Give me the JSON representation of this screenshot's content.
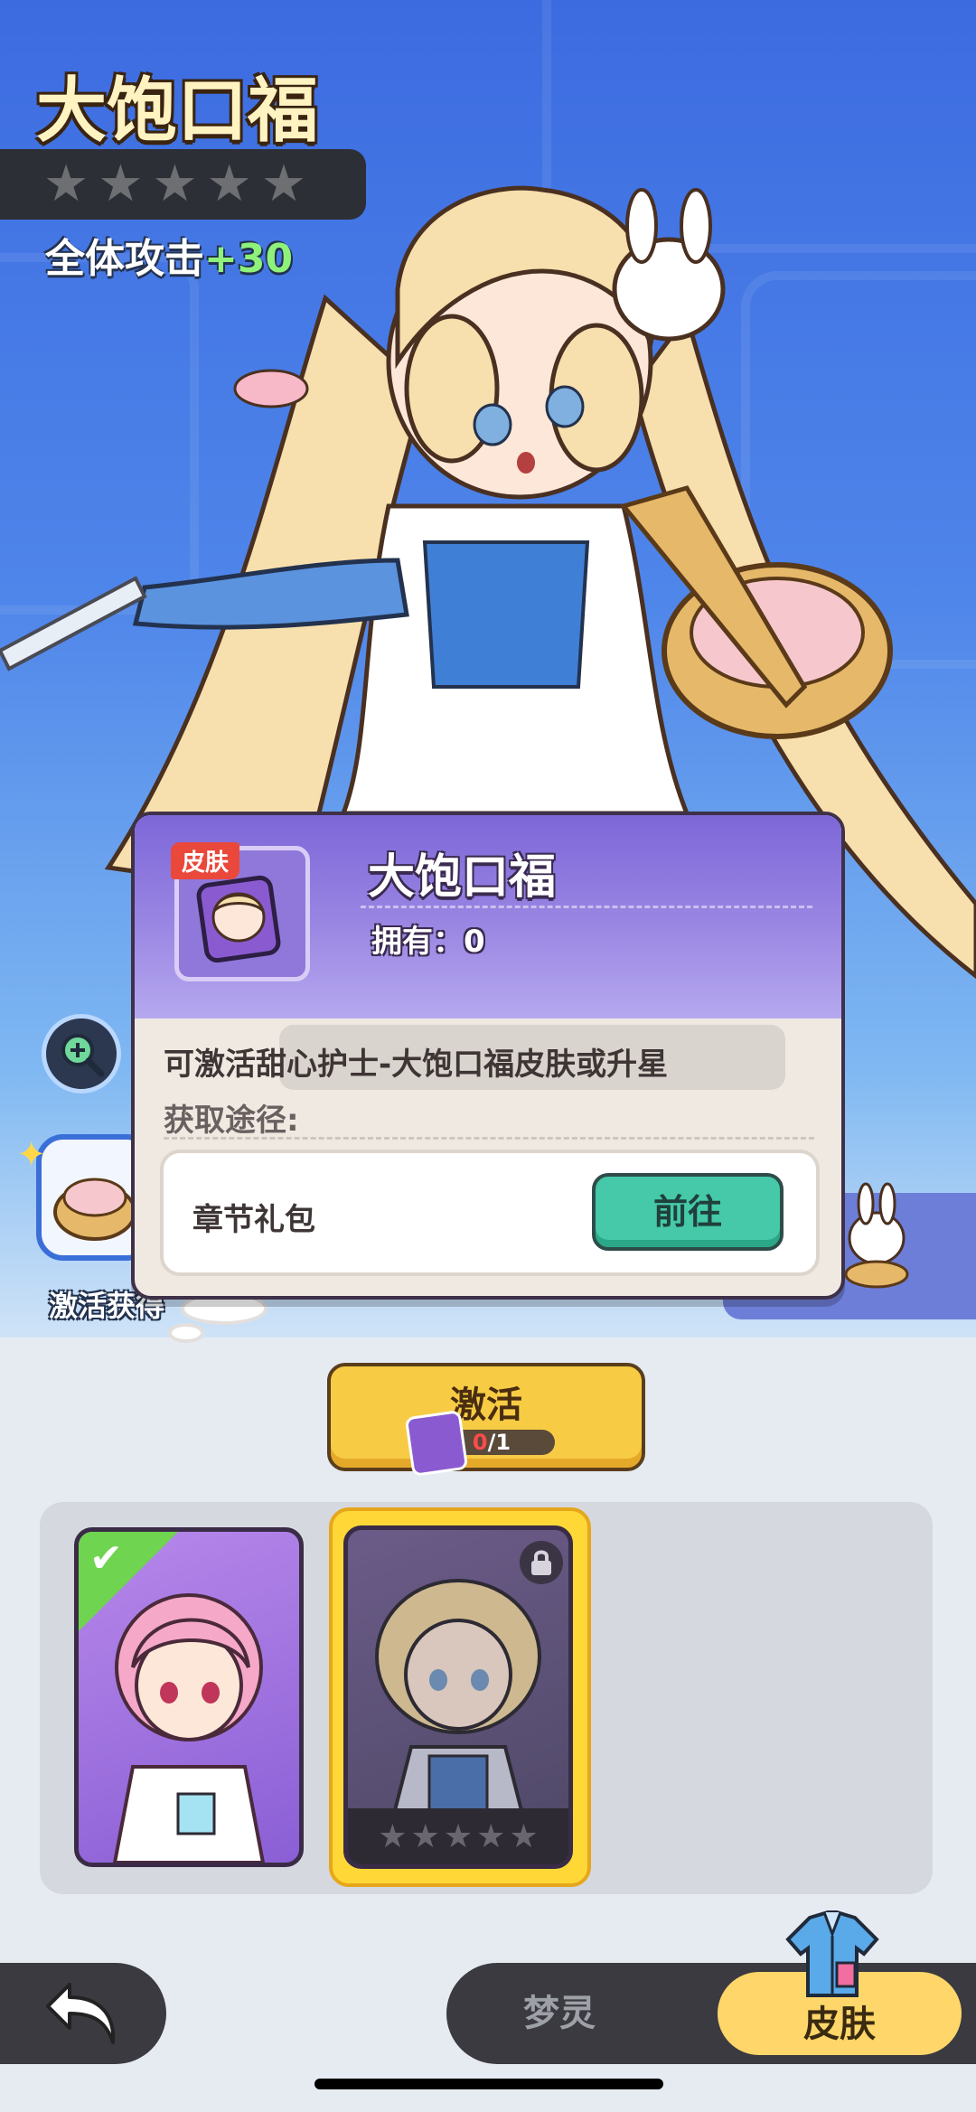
{
  "hero": {
    "title": "大饱口福",
    "stars_filled": 0,
    "stars_total": 5,
    "attack_label": "全体攻击",
    "attack_value": "+30"
  },
  "activate_source_label": "激活获得",
  "popup": {
    "tag": "皮肤",
    "name": "大饱口福",
    "owned": "拥有：0",
    "description": "可激活甜心护士-大饱口福皮肤或升星",
    "way_label": "获取途径:",
    "source_name": "章节礼包",
    "go_label": "前往"
  },
  "activate_button": {
    "label": "激活",
    "cost_have": "0",
    "cost_need": "/1"
  },
  "cards": [
    {
      "name": "nurse-default",
      "equipped": true,
      "locked": false
    },
    {
      "name": "dabaokoufu",
      "equipped": false,
      "locked": true,
      "stars_filled": 0,
      "stars_total": 5
    }
  ],
  "nav": {
    "tab_dream": "梦灵",
    "tab_skin": "皮肤",
    "active_tab": "皮肤"
  },
  "colors": {
    "accent_yellow": "#f7cc44",
    "go_green": "#45c9a8",
    "popup_purple": "#7d67d8",
    "attack_green": "#8ef27a"
  }
}
